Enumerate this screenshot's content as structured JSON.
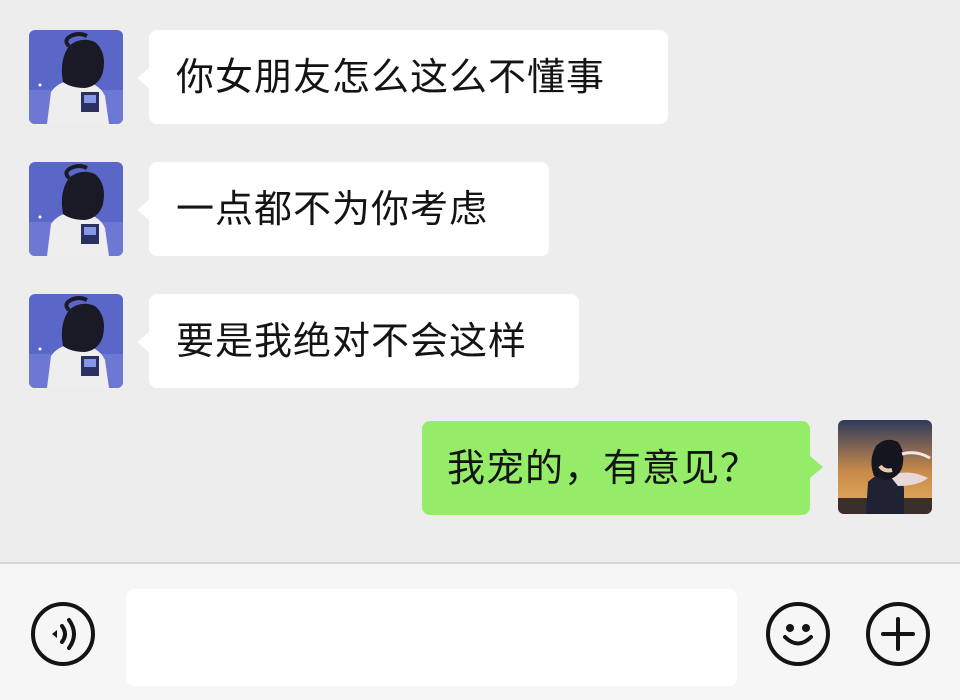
{
  "messages": [
    {
      "side": "left",
      "sender": "friend",
      "text": "你女朋友怎么这么不懂事"
    },
    {
      "side": "left",
      "sender": "friend",
      "text": "一点都不为你考虑"
    },
    {
      "side": "left",
      "sender": "friend",
      "text": "要是我绝对不会这样"
    },
    {
      "side": "right",
      "sender": "me",
      "text": "我宠的，有意见？"
    }
  ],
  "input_bar": {
    "input_value": "",
    "voice_icon": "voice-icon",
    "emoji_icon": "emoji-icon",
    "plus_icon": "plus-icon"
  },
  "colors": {
    "chat_background": "#ededed",
    "incoming_bubble": "#ffffff",
    "outgoing_bubble": "#95ec69",
    "input_bar": "#f6f6f6"
  }
}
